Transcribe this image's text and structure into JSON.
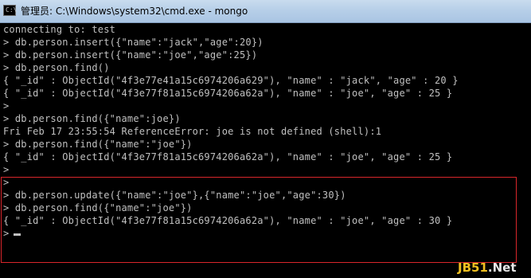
{
  "window": {
    "title": "管理员: C:\\Windows\\system32\\cmd.exe - mongo",
    "icon": "cmd-icon"
  },
  "console": {
    "lines": [
      "connecting to: test",
      "> db.person.insert({\"name\":\"jack\",\"age\":20})",
      "> db.person.insert({\"name\":\"joe\",\"age\":25})",
      "> db.person.find()",
      "{ \"_id\" : ObjectId(\"4f3e77e41a15c6974206a629\"), \"name\" : \"jack\", \"age\" : 20 }",
      "{ \"_id\" : ObjectId(\"4f3e77f81a15c6974206a62a\"), \"name\" : \"joe\", \"age\" : 25 }",
      ">",
      "> db.person.find({\"name\":joe})",
      "Fri Feb 17 23:55:54 ReferenceError: joe is not defined (shell):1",
      "> db.person.find({\"name\":\"joe\"})",
      "{ \"_id\" : ObjectId(\"4f3e77f81a15c6974206a62a\"), \"name\" : \"joe\", \"age\" : 25 }",
      ">",
      ">",
      "> db.person.update({\"name\":\"joe\"},{\"name\":\"joe\",\"age\":30})",
      "> db.person.find({\"name\":\"joe\"})",
      "{ \"_id\" : ObjectId(\"4f3e77f81a15c6974206a62a\"), \"name\" : \"joe\", \"age\" : 30 }"
    ],
    "prompt": ">"
  },
  "watermark": {
    "brand": "JB51",
    "suffix": ".Net"
  },
  "colors": {
    "console_bg": "#000000",
    "console_text": "#c0c0c0",
    "highlight": "#d9262b",
    "watermark_brand": "#f0c020"
  }
}
